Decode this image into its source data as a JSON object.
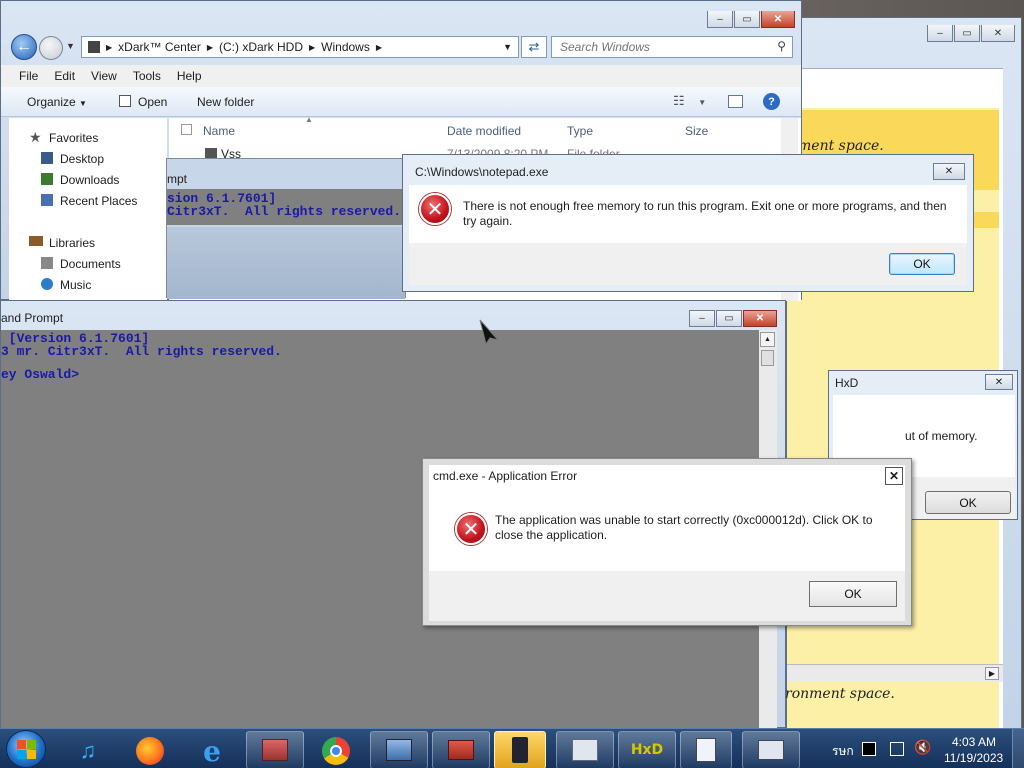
{
  "explorer": {
    "breadcrumb": [
      "xDark™ Center",
      "(C:) xDark HDD",
      "Windows"
    ],
    "search_placeholder": "Search Windows",
    "menu": [
      "File",
      "Edit",
      "View",
      "Tools",
      "Help"
    ],
    "toolbar": {
      "organize": "Organize",
      "open": "Open",
      "new_folder": "New folder"
    },
    "columns": {
      "name": "Name",
      "date": "Date modified",
      "type": "Type",
      "size": "Size"
    },
    "row": {
      "name": "Vss",
      "date": "7/13/2009 8:20 PM",
      "type": "File folder"
    },
    "favorites_label": "Favorites",
    "favorites": [
      "Desktop",
      "Downloads",
      "Recent Places"
    ],
    "libraries_label": "Libraries",
    "libraries": [
      "Documents",
      "Music"
    ]
  },
  "cmd_back": {
    "title": "mpt",
    "line1": "sion 6.1.7601]",
    "line2": "Citr3xT.  All rights reserved."
  },
  "cmd_front": {
    "title": "and Prompt",
    "line1": " [Version 6.1.7601]",
    "line2": "3 mr. Citr3xT.  All rights reserved.",
    "line3": "ey Oswald>"
  },
  "notepad_error": {
    "title": "C:\\Windows\\notepad.exe",
    "message": "There is not enough free memory to run this program. Exit one or more programs, and then try again.",
    "ok": "OK",
    "close": "✕"
  },
  "cmd_error": {
    "title": "cmd.exe - Application Error",
    "message": "The application was unable to start correctly (0xc000012d). Click OK to close the application.",
    "ok": "OK",
    "close": "✕"
  },
  "hxd_error": {
    "title": "HxD",
    "message": "ut of memory.",
    "ok": "OK",
    "close": "✕"
  },
  "notepad_bg": {
    "text_top": "nment space.",
    "text_bottom": "ronment space."
  },
  "taskbar": {
    "time": "4:03 AM",
    "date": "11/19/2023",
    "lang": "รษก"
  },
  "colors": {
    "taskbar": "#14305a",
    "console_bg": "#808080",
    "console_text": "#1a1aa6",
    "error_red": "#c1121c"
  }
}
